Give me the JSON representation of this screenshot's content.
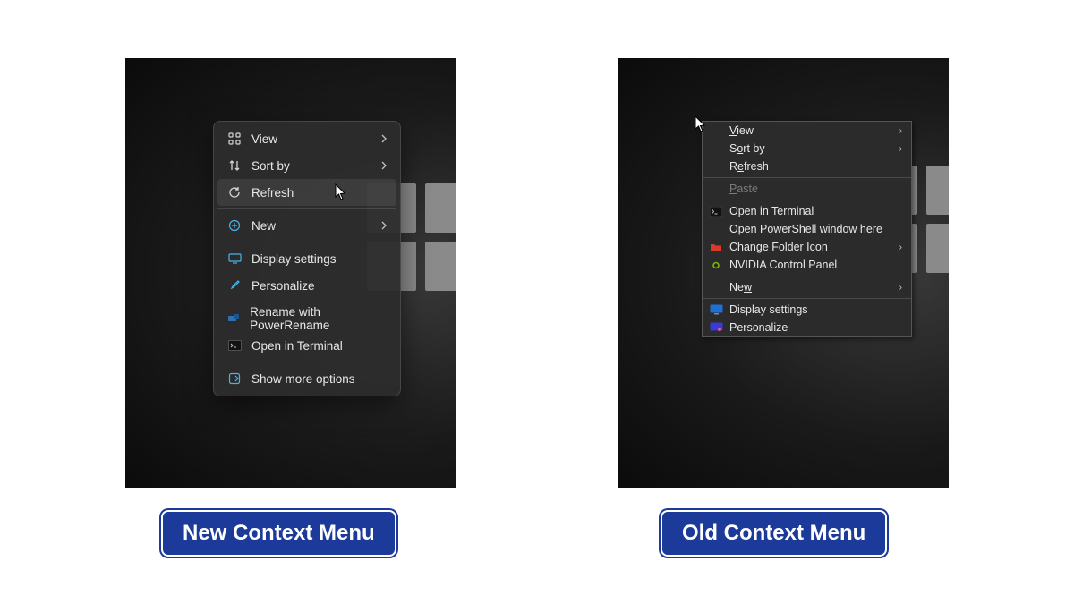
{
  "labels": {
    "new": "New Context Menu",
    "old": "Old Context Menu"
  },
  "new_menu": {
    "view": "View",
    "sort_by": "Sort by",
    "refresh": "Refresh",
    "new": "New",
    "display_settings": "Display settings",
    "personalize": "Personalize",
    "rename_pr": "Rename with PowerRename",
    "open_terminal": "Open in Terminal",
    "show_more": "Show more options"
  },
  "old_menu": {
    "view": "View",
    "sort_by": "Sort by",
    "refresh": "Refresh",
    "paste": "Paste",
    "open_terminal": "Open in Terminal",
    "open_powershell": "Open PowerShell window here",
    "change_folder_icon": "Change Folder Icon",
    "nvidia": "NVIDIA Control Panel",
    "new": "New",
    "display_settings": "Display settings",
    "personalize": "Personalize"
  }
}
